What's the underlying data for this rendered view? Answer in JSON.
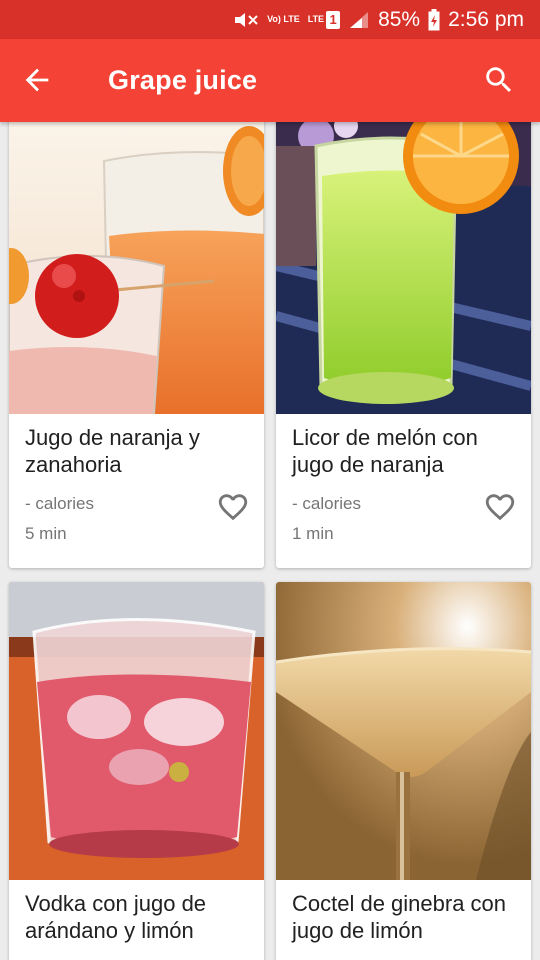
{
  "status_bar": {
    "volte": "Vo) LTE",
    "lte": "LTE",
    "sim": "1",
    "battery": "85%",
    "time": "2:56 pm"
  },
  "app_bar": {
    "title": "Grape juice",
    "back_icon": "arrow-back-icon",
    "search_icon": "search-icon"
  },
  "colors": {
    "status_bar": "#d8312a",
    "app_bar": "#f44336"
  },
  "recipes": [
    {
      "title": "Jugo de naranja y zanahoria",
      "calories": "- calories",
      "time": "5 min",
      "favorite_icon": "heart-outline-icon"
    },
    {
      "title": "Licor de melón con jugo de naranja",
      "calories": "- calories",
      "time": "1 min",
      "favorite_icon": "heart-outline-icon"
    },
    {
      "title": "Vodka con jugo de arándano y limón"
    },
    {
      "title": "Coctel de ginebra con jugo de limón"
    }
  ]
}
